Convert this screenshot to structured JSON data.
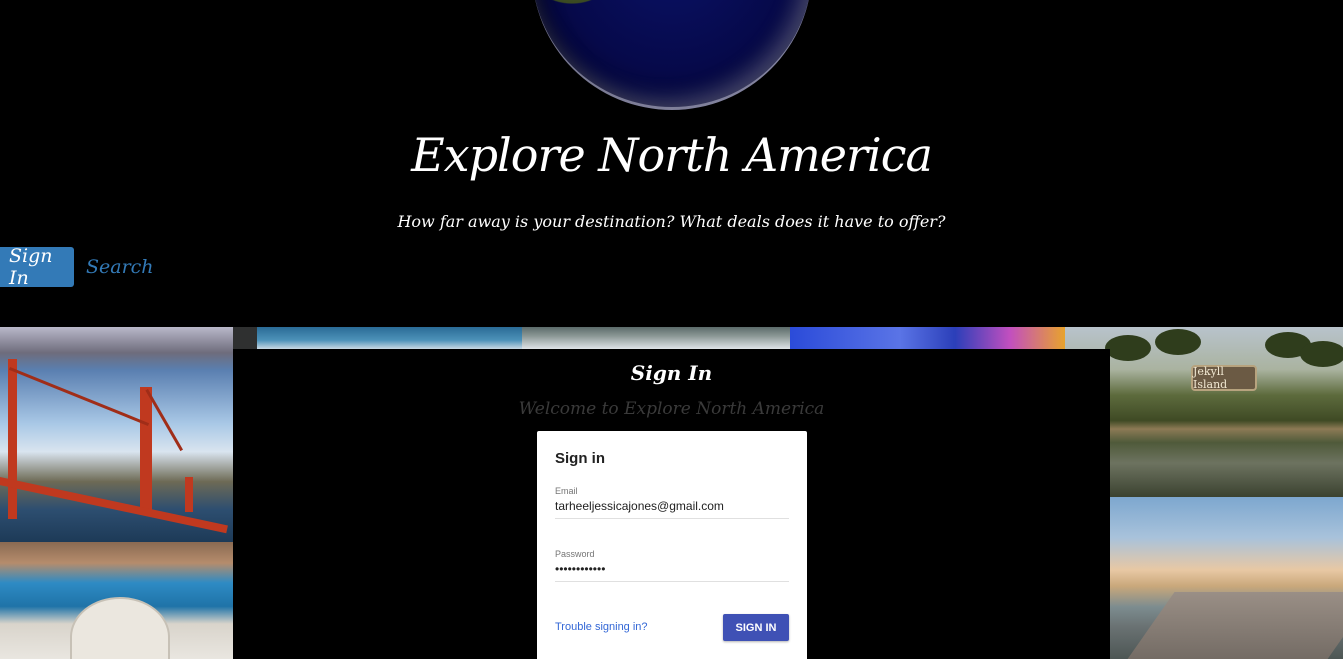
{
  "header": {
    "title": "Explore North America",
    "subtitle": "How far away is your destination? What deals does it have to offer?"
  },
  "nav": {
    "signin_label": "Sign In",
    "search_label": "Search"
  },
  "panel": {
    "title": "Sign In",
    "welcome": "Welcome to Explore North America"
  },
  "auth_card": {
    "title": "Sign in",
    "email_label": "Email",
    "email_value": "tarheeljessicajones@gmail.com",
    "password_label": "Password",
    "password_value": "••••••••••••",
    "trouble_link": "Trouble signing in?",
    "signin_button": "SIGN IN"
  },
  "photos": {
    "jekyll_sign_text": "Jekyll Island"
  },
  "colors": {
    "nav_active": "#337ab7",
    "primary_button": "#3f51b5",
    "link": "#3367d6"
  }
}
